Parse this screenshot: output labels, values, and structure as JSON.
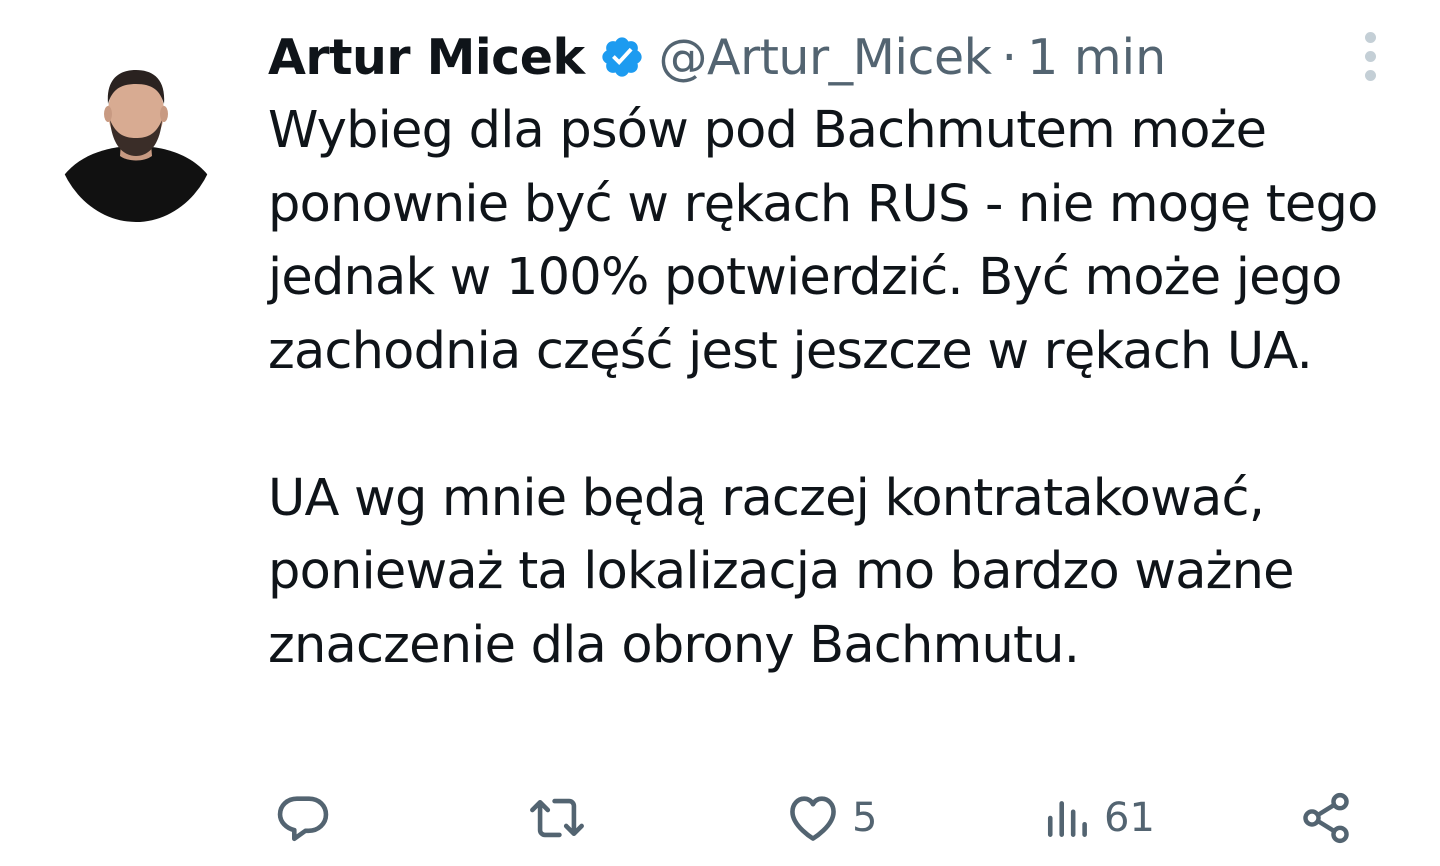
{
  "tweet": {
    "author_name": "Artur Micek",
    "handle": "@Artur_Micek",
    "separator": "·",
    "time": "1 min",
    "paragraphs": [
      "Wybieg dla psów pod Bachmutem może ponownie być w rękach RUS - nie mogę tego jednak w 100% potwierdzić. Być może jego zachodnia część jest jeszcze w rękach UA.",
      "UA wg mnie będą raczej kontratakować, ponieważ ta lokalizacja mo bardzo ważne znaczenie dla obrony Bachmutu."
    ]
  },
  "actions": {
    "reply_icon": "reply-icon",
    "retweet_icon": "retweet-icon",
    "like_icon": "heart-icon",
    "like_count": "5",
    "views_icon": "views-icon",
    "views_count": "61",
    "share_icon": "share-icon"
  },
  "colors": {
    "text": "#0f1419",
    "secondary": "#536471",
    "verified": "#1d9bf0",
    "more_dots": "#c4cfd6"
  }
}
